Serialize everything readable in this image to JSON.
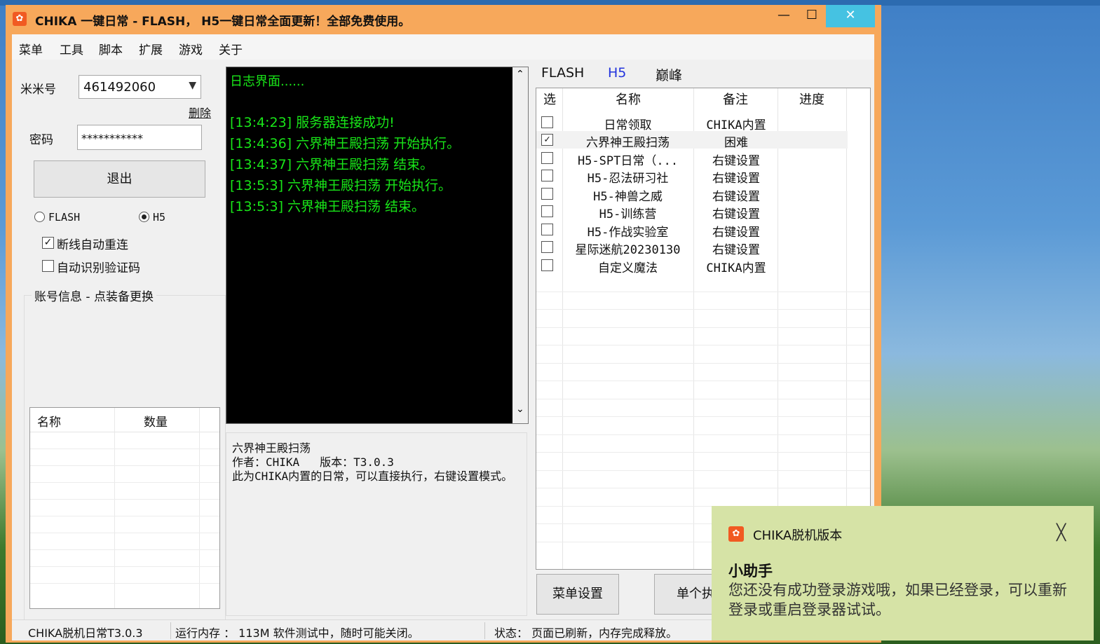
{
  "window": {
    "title": "CHIKA 一键日常 - FLASH， H5一键日常全面更新！全部免费使用。",
    "minimize": "—",
    "maximize": "☐",
    "close": "✕",
    "accent_color": "#f7a85b"
  },
  "menu": [
    "菜单",
    "工具",
    "脚本",
    "扩展",
    "游戏",
    "关于"
  ],
  "login": {
    "account_label": "米米号",
    "account_value": "461492060",
    "delete_label": "删除",
    "password_label": "密码",
    "password_value": "***********",
    "exit_button": "退出",
    "mode_flash": "FLASH",
    "mode_h5": "H5",
    "selected_mode": "H5",
    "auto_reconnect": "断线自动重连",
    "auto_reconnect_checked": true,
    "auto_captcha": "自动识别验证码",
    "auto_captcha_checked": false
  },
  "account_info": {
    "title": "账号信息 - 点装备更换",
    "columns": [
      "名称",
      "数量"
    ]
  },
  "log": {
    "lines": [
      "日志界面......",
      "",
      "[13:4:23] 服务器连接成功!",
      "[13:4:36] 六界神王殿扫荡 开始执行。",
      "[13:4:37] 六界神王殿扫荡 结束。",
      "[13:5:3] 六界神王殿扫荡 开始执行。",
      "[13:5:3] 六界神王殿扫荡 结束。"
    ],
    "scroll_up": "⌃",
    "scroll_down": "⌄"
  },
  "description": {
    "name": "六界神王殿扫荡",
    "author_line": "作者：CHIKA   版本：T3.0.3",
    "text": "此为CHIKA内置的日常，可以直接执行，右键设置模式。"
  },
  "script_tabs": [
    "FLASH",
    "H5",
    "巅峰"
  ],
  "active_tab": "H5",
  "script_list": {
    "columns": [
      "选",
      "名称",
      "备注",
      "进度"
    ],
    "rows": [
      {
        "checked": false,
        "name": "日常领取",
        "note": "CHIKA内置"
      },
      {
        "checked": true,
        "name": "六界神王殿扫荡",
        "note": "困难"
      },
      {
        "checked": false,
        "name": "H5-SPT日常（...",
        "note": "右键设置"
      },
      {
        "checked": false,
        "name": "H5-忍法研习社",
        "note": "右键设置"
      },
      {
        "checked": false,
        "name": "H5-神兽之威",
        "note": "右键设置"
      },
      {
        "checked": false,
        "name": "H5-训练营",
        "note": "右键设置"
      },
      {
        "checked": false,
        "name": "H5-作战实验室",
        "note": "右键设置"
      },
      {
        "checked": false,
        "name": "星际迷航20230130",
        "note": "右键设置"
      },
      {
        "checked": false,
        "name": "自定义魔法",
        "note": "CHIKA内置"
      }
    ]
  },
  "buttons": {
    "menu_settings": "菜单设置",
    "single_exec": "单个执"
  },
  "status": {
    "version": "CHIKA脱机日常T3.0.3",
    "memory": "运行内存 ： 113M 软件测试中，随时可能关闭。",
    "state": "状态：   页面已刷新，内存完成释放。"
  },
  "toast": {
    "app": "CHIKA脱机版本",
    "close": "╳",
    "title": "小助手",
    "body": "您还没有成功登录游戏哦，如果已经登录，可以重新登录或重启登录器试试。",
    "bg_color": "#d6e3a6"
  }
}
